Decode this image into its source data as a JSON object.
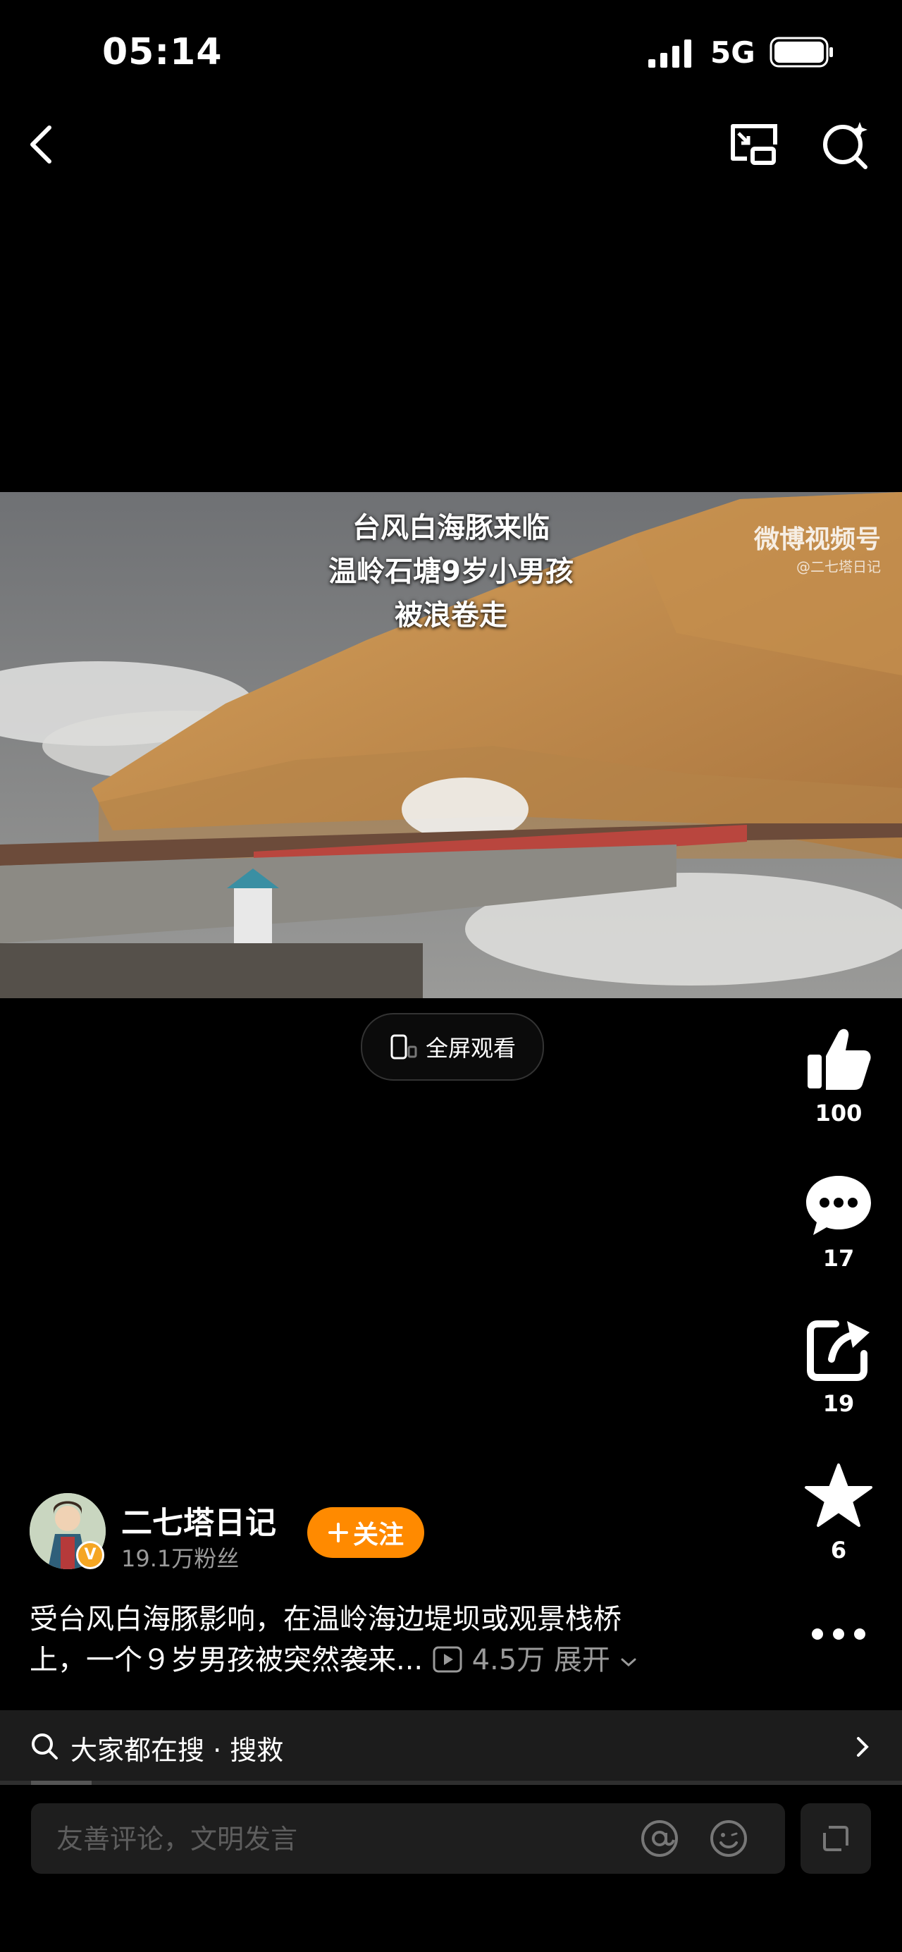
{
  "status": {
    "time": "05:14",
    "network": "5G"
  },
  "video": {
    "caption_lines": [
      "台风白海豚来临",
      "温岭石塘9岁小男孩",
      "被浪卷走"
    ],
    "watermark": "微博视频号",
    "watermark_sub": "@二七塔日记"
  },
  "fullscreen": {
    "label": "全屏观看"
  },
  "actions": {
    "like_count": "100",
    "comment_count": "17",
    "share_count": "19",
    "favorite_count": "6"
  },
  "author": {
    "name": "二七塔日记",
    "fans": "19.1万粉丝",
    "follow_label": "关注",
    "verified_mark": "V"
  },
  "description": {
    "line1": "受台风白海豚影响，在温岭海边堤坝或观景栈桥",
    "line2": "上，一个９岁男孩被突然袭来...",
    "views": "4.5万",
    "expand_label": "展开"
  },
  "search": {
    "prefix": "大家都在搜",
    "separator": "·",
    "keyword": "搜救"
  },
  "comment": {
    "placeholder": "友善评论，文明发言"
  },
  "colors": {
    "accent": "#ff8a00",
    "background": "#000000"
  }
}
